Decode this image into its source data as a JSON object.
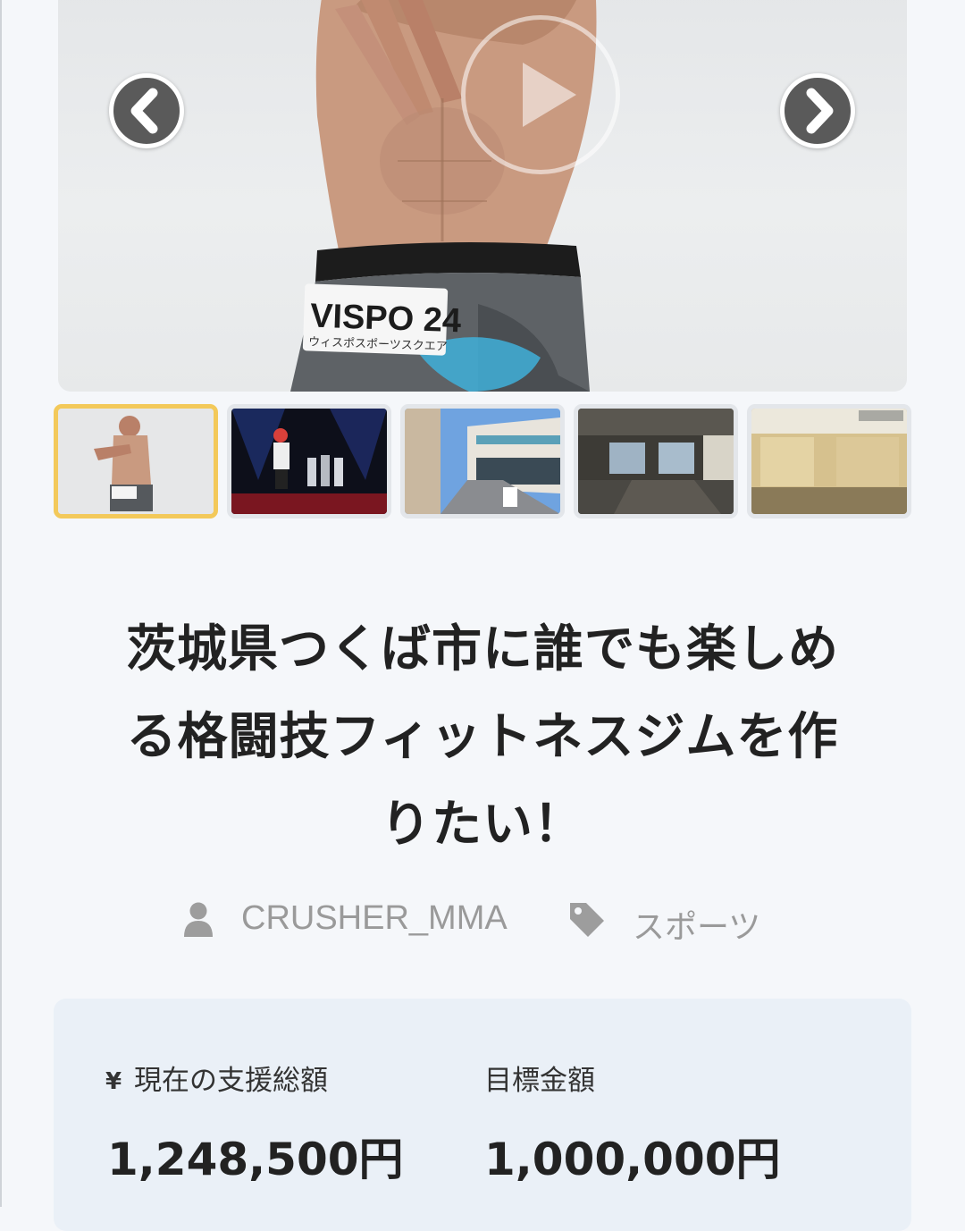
{
  "project": {
    "title_line1": "茨城県つくば市に誰でも楽しめ",
    "title_line2": "る格闘技フィットネスジムを作",
    "title_line3": "りたい！",
    "owner": "CRUSHER_MMA",
    "category": "スポーツ"
  },
  "hero": {
    "shorts_label_big": "VISPO 24",
    "shorts_label_small": "ウィスポスポーツスクエア"
  },
  "thumbnails": {
    "count": 5,
    "active_index": 0
  },
  "funding": {
    "current_label": "現在の支援総額",
    "current_amount": "1,248,500円",
    "goal_label": "目標金額",
    "goal_amount": "1,000,000円",
    "currency_symbol": "¥"
  },
  "icons": {
    "prev": "chevron-left-icon",
    "next": "chevron-right-icon",
    "play": "play-icon",
    "owner": "user-icon",
    "category": "tag-icon",
    "currency": "yen-icon"
  },
  "colors": {
    "active_thumb_border": "#f3c95a",
    "card_background": "#eaf0f7",
    "nav_button": "#5a5a5a"
  }
}
